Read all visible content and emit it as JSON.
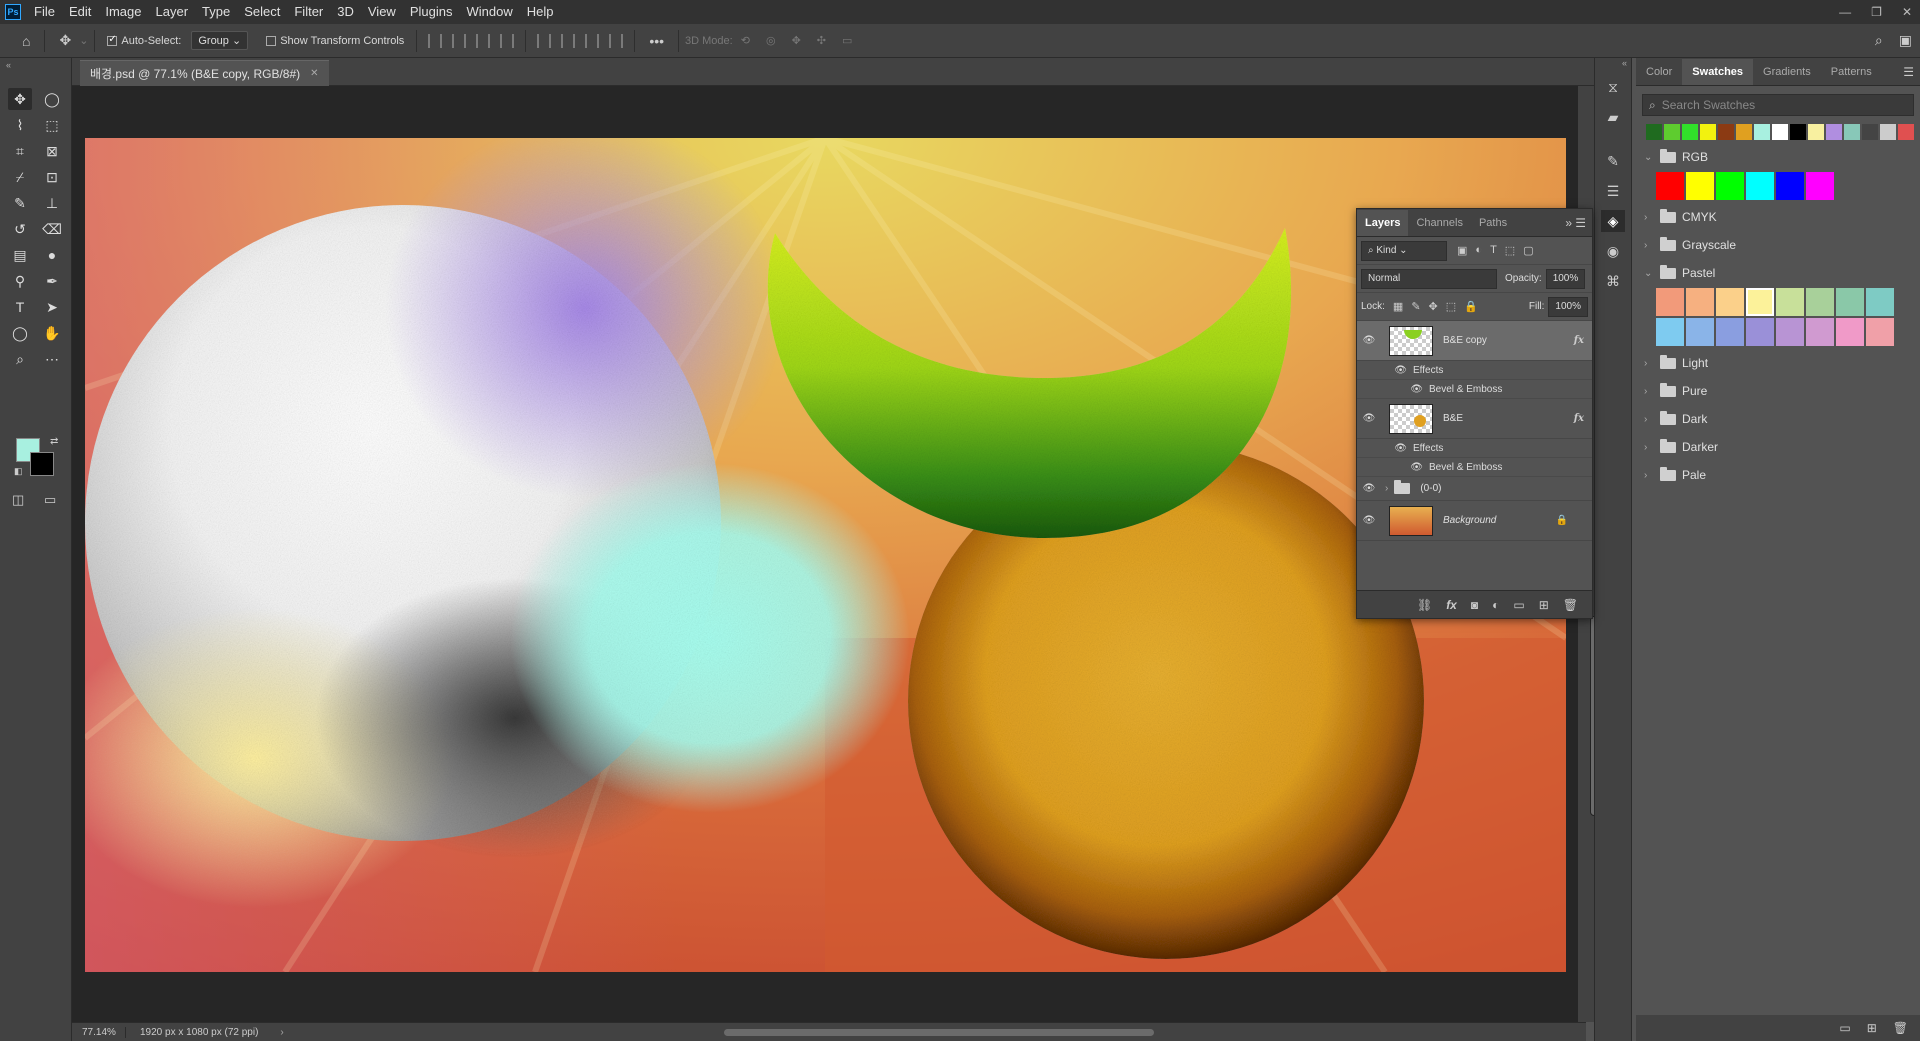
{
  "app": {
    "menus": [
      "File",
      "Edit",
      "Image",
      "Layer",
      "Type",
      "Select",
      "Filter",
      "3D",
      "View",
      "Plugins",
      "Window",
      "Help"
    ]
  },
  "options": {
    "auto_select": "Auto-Select:",
    "auto_select_value": "Group",
    "show_transform": "Show Transform Controls",
    "mode_3d": "3D Mode:"
  },
  "document": {
    "tab_title": "배경.psd @ 77.1% (B&E copy, RGB/8#)",
    "zoom": "77.14%",
    "doc_info": "1920 px x 1080 px (72 ppi)"
  },
  "colors": {
    "foreground": "#a8f0e0",
    "background": "#000000"
  },
  "swatches": {
    "tabs": [
      "Color",
      "Swatches",
      "Gradients",
      "Patterns"
    ],
    "active_tab": "Swatches",
    "search_placeholder": "Search Swatches",
    "recent": [
      "#1f6b1f",
      "#5ecc2f",
      "#31e02a",
      "#f2f20f",
      "#8b3a13",
      "#e0a020",
      "#a8f0e0",
      "#ffffff",
      "#000000",
      "#f8f0a0",
      "#b08ee0",
      "#88c8b8",
      "#444444",
      "#cccccc",
      "#e05050"
    ],
    "groups": [
      {
        "name": "RGB",
        "expanded": true,
        "colors": [
          "#ff0000",
          "#ffff00",
          "#00ff00",
          "#00ffff",
          "#0000ff",
          "#ff00ff"
        ]
      },
      {
        "name": "CMYK",
        "expanded": false
      },
      {
        "name": "Grayscale",
        "expanded": false
      },
      {
        "name": "Pastel",
        "expanded": true,
        "colors": [
          "#f29a7a",
          "#f6b080",
          "#fbd08a",
          "#fcf29a",
          "#c8e09a",
          "#a8d09a",
          "#8ac8a8",
          "#7ecbc4",
          "#7ecbf0",
          "#8ab4e8",
          "#8a9ee0",
          "#9a90d8",
          "#b894d4",
          "#d09ad0",
          "#f09ac8",
          "#f0a0a8"
        ],
        "selected": 3
      },
      {
        "name": "Light",
        "expanded": false
      },
      {
        "name": "Pure",
        "expanded": false
      },
      {
        "name": "Dark",
        "expanded": false
      },
      {
        "name": "Darker",
        "expanded": false
      },
      {
        "name": "Pale",
        "expanded": false
      }
    ]
  },
  "layers": {
    "tabs": [
      "Layers",
      "Channels",
      "Paths"
    ],
    "active_tab": "Layers",
    "kind": "Kind",
    "blend": "Normal",
    "opacity_label": "Opacity:",
    "opacity": "100%",
    "lock_label": "Lock:",
    "fill_label": "Fill:",
    "fill": "100%",
    "items": [
      {
        "name": "B&E copy",
        "fx": "fx",
        "effects_label": "Effects",
        "effect": "Bevel & Emboss",
        "selected": true
      },
      {
        "name": "B&E",
        "fx": "fx",
        "effects_label": "Effects",
        "effect": "Bevel & Emboss",
        "selected": false
      },
      {
        "name": "(0-0)",
        "group": true
      },
      {
        "name": "Background",
        "locked": true
      }
    ]
  }
}
